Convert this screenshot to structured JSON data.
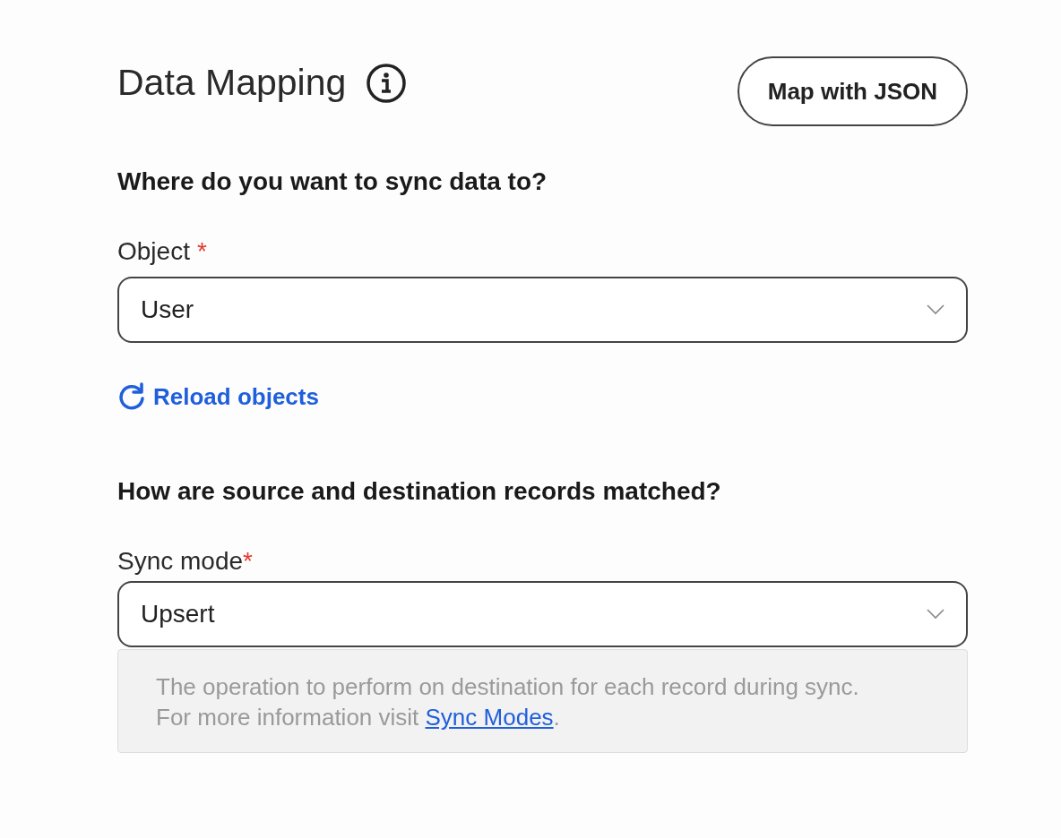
{
  "header": {
    "title": "Data Mapping",
    "button": "Map with JSON"
  },
  "sections": [
    {
      "heading": "Where do you want to sync data to?",
      "field": {
        "label": "Object",
        "required_mark": "*",
        "value": "User"
      },
      "link": "Reload objects"
    },
    {
      "heading": "How are source and destination records matched?",
      "field": {
        "label": "Sync mode",
        "required_mark": "*",
        "value": "Upsert"
      },
      "help": {
        "text": "The operation to perform on destination for each record during sync. For more information visit ",
        "link": "Sync Modes",
        "after": "."
      }
    }
  ]
}
